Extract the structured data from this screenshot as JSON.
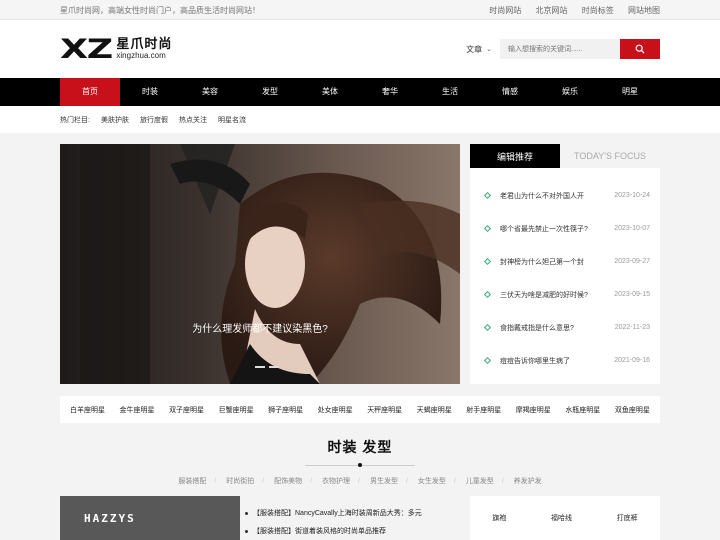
{
  "topbar": {
    "tagline": "星爪时尚网，高端女性时尚门户，高品质生活时尚网站！",
    "links": [
      "时尚网站",
      "北京网站",
      "时尚标签",
      "网站地图"
    ]
  },
  "logo": {
    "mark": "XZ",
    "name": "星爪时尚",
    "domain": "xingzhua.com"
  },
  "search": {
    "scope": "文章",
    "placeholder": "输入想搜索的关键词......"
  },
  "nav": [
    "首页",
    "时装",
    "美容",
    "发型",
    "美体",
    "奢华",
    "生活",
    "情感",
    "娱乐",
    "明星"
  ],
  "hot": {
    "label": "热门栏目:",
    "items": [
      "美肤护肤",
      "旅行度假",
      "热点关注",
      "明星名流"
    ]
  },
  "hero": {
    "caption": "为什么理发师都不建议染黑色?"
  },
  "editor": {
    "tab_active": "编辑推荐",
    "tab_inactive": "TODAY'S FOCUS",
    "items": [
      {
        "title": "老君山为什么不对外国人开",
        "date": "2023-10-24"
      },
      {
        "title": "哪个省最先禁止一次性筷子?",
        "date": "2023-10-07"
      },
      {
        "title": "封神榜为什么妲己第一个封",
        "date": "2023-09-27"
      },
      {
        "title": "三伏天为啥是减肥的好时候?",
        "date": "2023-09-15"
      },
      {
        "title": "食指戴戒指是什么意思?",
        "date": "2022-11-23"
      },
      {
        "title": "痘痘告诉你哪里生病了",
        "date": "2021-09-16"
      }
    ]
  },
  "zodiac": [
    "白羊座明星",
    "金牛座明星",
    "双子座明星",
    "巨蟹座明星",
    "狮子座明星",
    "处女座明星",
    "天秤座明星",
    "天蝎座明星",
    "射手座明星",
    "摩羯座明星",
    "水瓶座明星",
    "双鱼座明星"
  ],
  "section": {
    "title": "时装 发型",
    "subcats": [
      "服装搭配",
      "时尚街拍",
      "配饰美物",
      "衣物护理",
      "男生发型",
      "女生发型",
      "儿童发型",
      "养发护发"
    ]
  },
  "bottom": {
    "thumb_brand": "HAZZYS",
    "news": [
      "【服装搭配】NancyCavally上海时装周新品大秀：多元",
      "【服装搭配】街道着装风格的时尚单品推荐"
    ],
    "tags": [
      "旗袍",
      "福哈线",
      "打底裤"
    ]
  },
  "colors": {
    "accent": "#c8101a",
    "nav_bg": "#000000",
    "bullet": "#38a876"
  }
}
